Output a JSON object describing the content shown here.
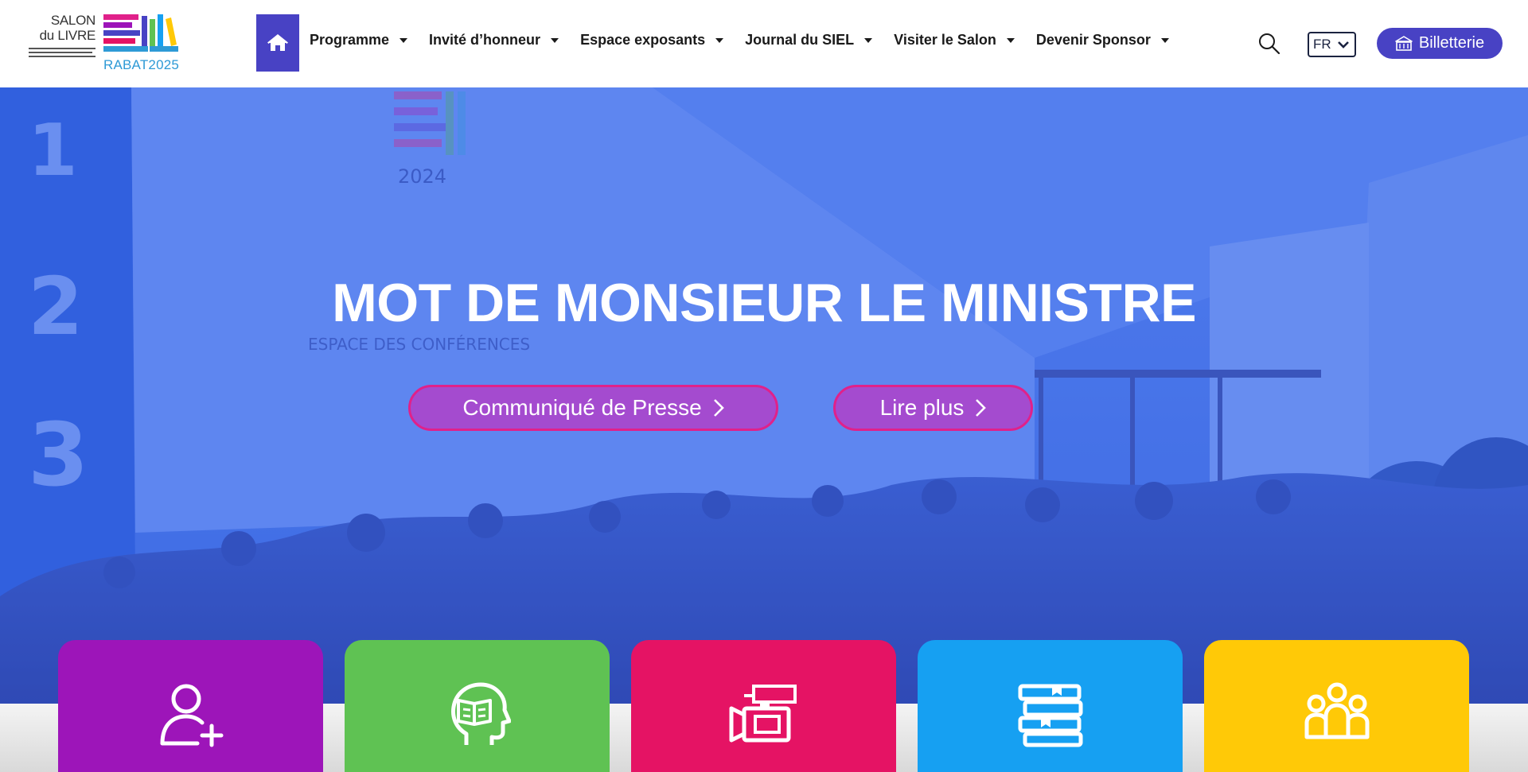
{
  "header": {
    "logo": {
      "line1": "SALON",
      "line2": "du LIVRE",
      "year_text": "RABAT2025",
      "icon": "siel-books-logo",
      "bar_colors": [
        "#e0218a",
        "#9d15b9",
        "#4842c4",
        "#2e9ad6",
        "#5fc253",
        "#ffc907"
      ]
    },
    "home_icon": "home-icon",
    "nav": [
      {
        "label": "Programme"
      },
      {
        "label": "Invité d’honneur"
      },
      {
        "label": "Espace exposants"
      },
      {
        "label": "Journal du SIEL"
      },
      {
        "label": "Visiter le Salon"
      },
      {
        "label": "Devenir Sponsor"
      }
    ],
    "search_icon": "search-icon",
    "language": {
      "selected": "FR"
    },
    "ticket_button": {
      "label": "Billetterie",
      "icon": "ticket-building-icon"
    }
  },
  "hero": {
    "title": "MOT DE MONSIEUR LE MINISTRE",
    "buttons": [
      {
        "label": "Communiqué de Presse",
        "icon": "chevron-right-icon"
      },
      {
        "label": "Lire plus",
        "icon": "chevron-right-icon"
      }
    ],
    "background": "crowd-at-book-fair-photo",
    "scene_text": {
      "pillar_numbers": [
        "1",
        "2",
        "3"
      ],
      "sign_year": "2024",
      "sign_conferences": "ESPACE DES CONFÉRENCES"
    }
  },
  "cards": [
    {
      "icon": "add-user-icon",
      "color": "#9d15b9"
    },
    {
      "icon": "reading-head-icon",
      "color": "#5fc253"
    },
    {
      "icon": "video-camera-icon",
      "color": "#e51364"
    },
    {
      "icon": "books-stack-icon",
      "color": "#16a0f2"
    },
    {
      "icon": "group-icon",
      "color": "#ffc907"
    }
  ],
  "colors": {
    "brand": "#4842c4",
    "hero_overlay": "#3f73e6",
    "button_border": "#e0218a"
  }
}
